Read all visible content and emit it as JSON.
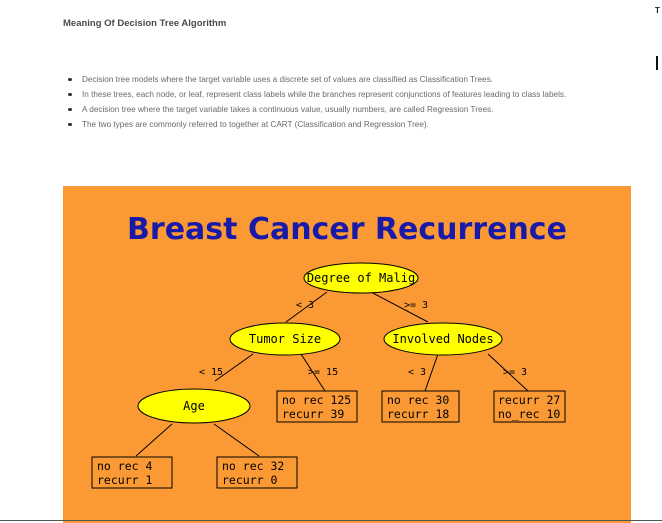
{
  "article": {
    "heading": "Meaning Of Decision Tree Algorithm",
    "corner_mark": "T",
    "bullets": [
      "Decision tree models where the target variable uses a discrete set of values are classified as Classification Trees.",
      "In these trees, each node, or leaf, represent class labels while the branches represent conjunctions of features leading to class labels.",
      "A decision tree where the target variable takes a continuous value, usually numbers, are called Regression Trees.",
      "The two types are commonly referred to together at CART (Classification and Regression Tree)."
    ]
  },
  "slide": {
    "title": "Breast Cancer Recurrence",
    "colors": {
      "background": "#fb9a35",
      "title": "#1a1aa8",
      "node_fill": "#ffff00",
      "leaf_fill": "#fb9a35"
    },
    "nodes": {
      "root": "Degree of Malig",
      "tumor_size": "Tumor Size",
      "involved_nodes": "Involved Nodes",
      "age": "Age"
    },
    "edges": {
      "root_left": "< 3",
      "root_right": ">= 3",
      "tumor_left": "< 15",
      "tumor_right": ">= 15",
      "involved_left": "< 3",
      "involved_right": ">= 3"
    },
    "leaves": {
      "tumor_right": [
        "no rec 125",
        "recurr 39"
      ],
      "involved_left": [
        "no rec 30",
        "recurr 18"
      ],
      "involved_right": [
        "recurr 27",
        "no_rec 10"
      ],
      "age_left": [
        "no rec 4",
        "recurr 1"
      ],
      "age_right": [
        "no rec 32",
        "recurr 0"
      ]
    }
  }
}
